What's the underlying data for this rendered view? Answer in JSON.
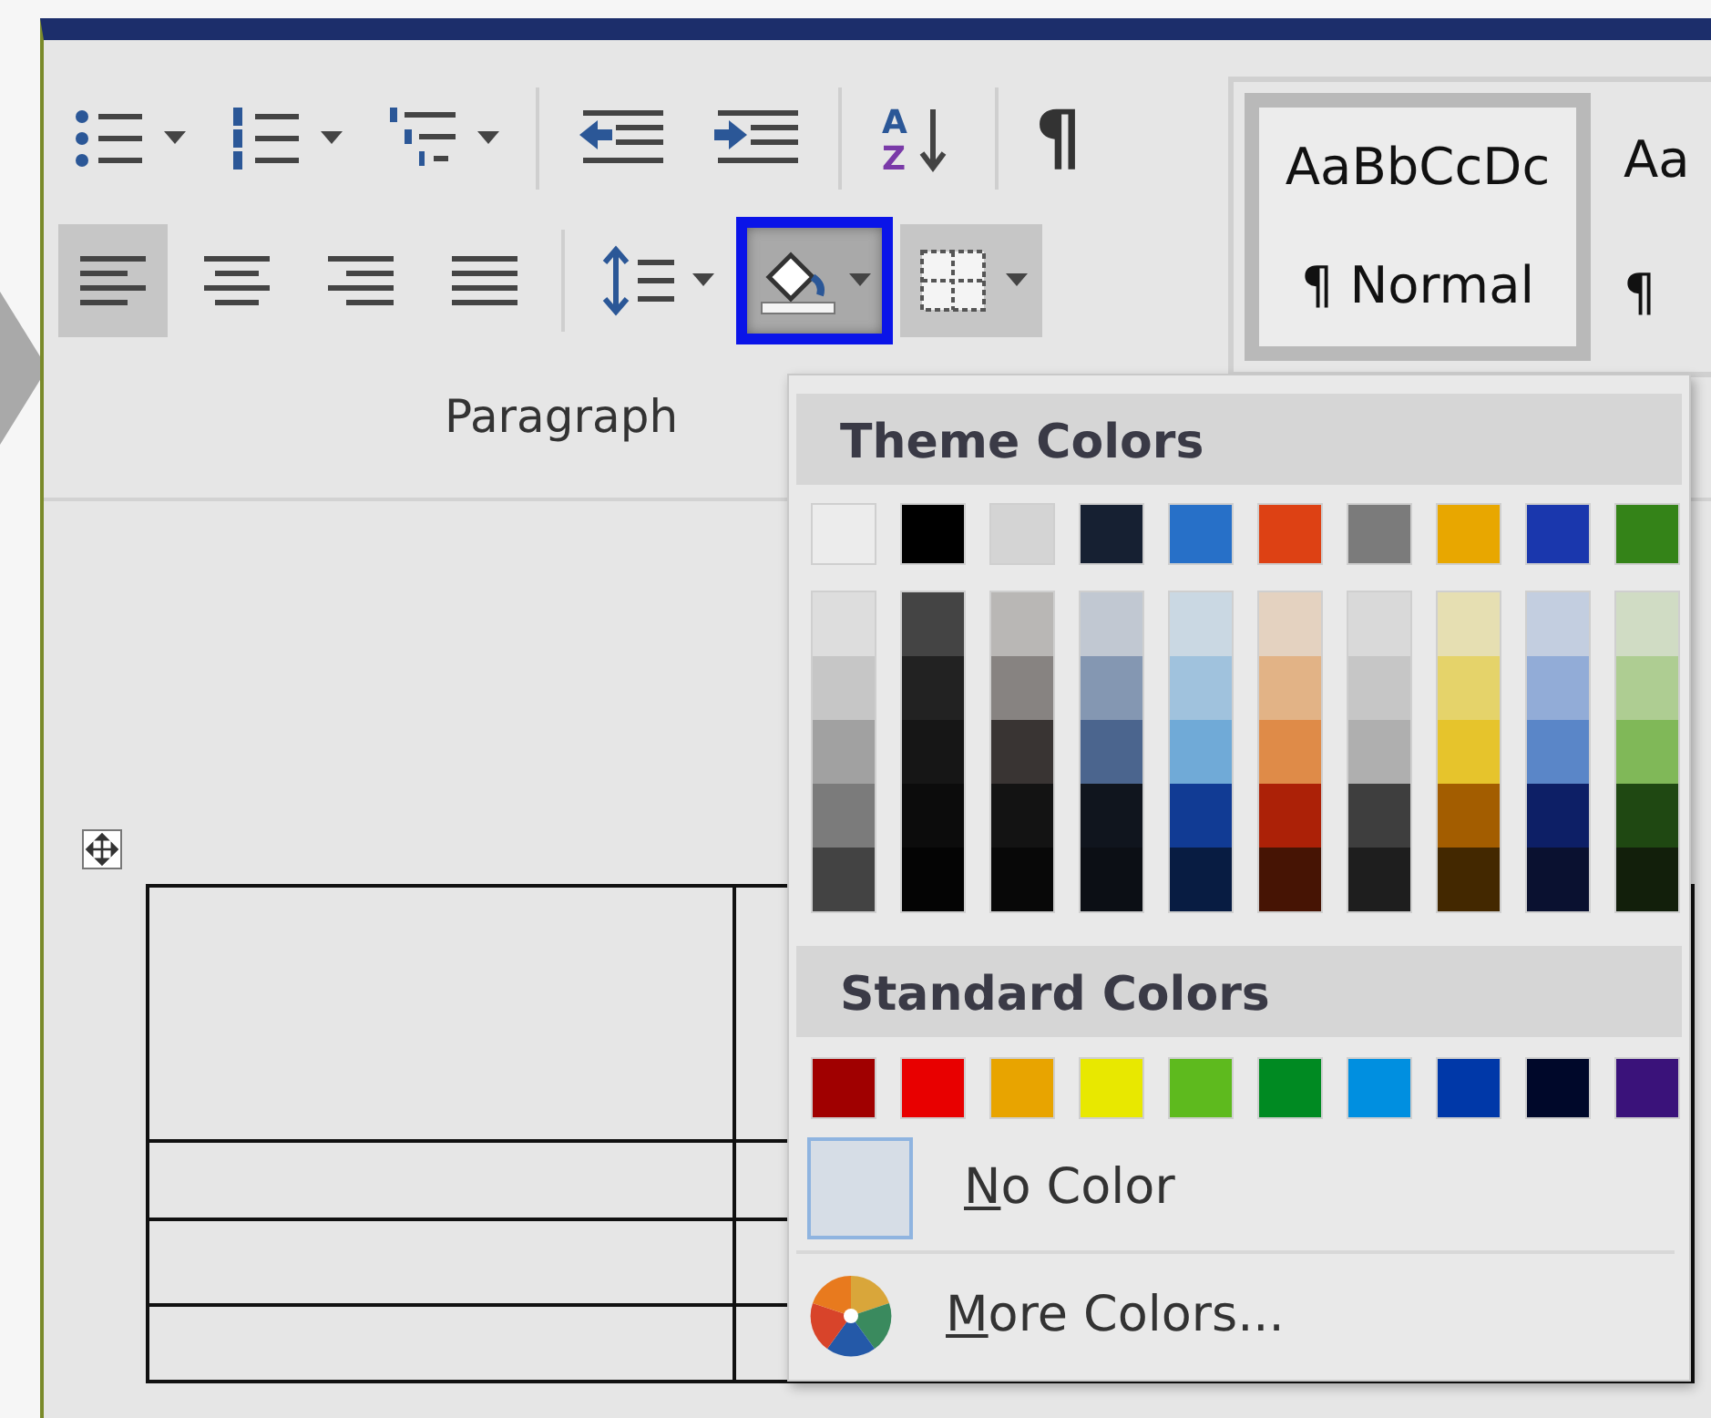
{
  "ribbon": {
    "rows": [
      [
        {
          "kind": "bullets",
          "dropdown": true,
          "selected": false
        },
        {
          "kind": "numbering",
          "dropdown": true,
          "selected": false
        },
        {
          "kind": "multilevel",
          "dropdown": true,
          "selected": false
        },
        {
          "kind": "separator"
        },
        {
          "kind": "outdent",
          "dropdown": false,
          "selected": false
        },
        {
          "kind": "indent",
          "dropdown": false,
          "selected": false
        },
        {
          "kind": "separator"
        },
        {
          "kind": "sort",
          "dropdown": false,
          "selected": false,
          "letters": [
            "A",
            "Z"
          ]
        },
        {
          "kind": "separator"
        },
        {
          "kind": "pilcrow",
          "dropdown": false,
          "selected": false,
          "label": "¶"
        }
      ],
      [
        {
          "kind": "align-left",
          "dropdown": false,
          "selected": true
        },
        {
          "kind": "align-center",
          "dropdown": false,
          "selected": false
        },
        {
          "kind": "align-right",
          "dropdown": false,
          "selected": false
        },
        {
          "kind": "justify",
          "dropdown": false,
          "selected": false
        },
        {
          "kind": "separator"
        },
        {
          "kind": "line-spacing",
          "dropdown": true,
          "selected": false
        },
        {
          "kind": "shading",
          "dropdown": true,
          "selected": true,
          "highlighted": true
        },
        {
          "kind": "borders",
          "dropdown": true,
          "selected": true
        }
      ]
    ],
    "group_label": "Paragraph",
    "styles": [
      {
        "sample": "AaBbCcDc",
        "name": "¶ Normal",
        "selected": true
      },
      {
        "sample": "Aa",
        "name": "¶",
        "selected": false
      }
    ]
  },
  "menu": {
    "theme_title": "Theme Colors",
    "theme_colors": [
      {
        "color": "#ececec"
      },
      {
        "color": "#000000"
      },
      {
        "color": "#d4d4d4"
      },
      {
        "color": "#162032"
      },
      {
        "color": "#2770c8"
      },
      {
        "color": "#dd4114"
      },
      {
        "color": "#7b7b7b"
      },
      {
        "color": "#e8a700"
      },
      {
        "color": "#1a37ad"
      },
      {
        "color": "#348318"
      }
    ],
    "shades": [
      [
        {
          "color": "#dddddd"
        },
        {
          "color": "#c6c6c6"
        },
        {
          "color": "#a1a1a1"
        },
        {
          "color": "#7b7b7b"
        },
        {
          "color": "#434343"
        }
      ],
      [
        {
          "color": "#444444"
        },
        {
          "color": "#222222"
        },
        {
          "color": "#161616"
        },
        {
          "color": "#0c0c0c"
        },
        {
          "color": "#040404"
        }
      ],
      [
        {
          "color": "#b9b7b5"
        },
        {
          "color": "#878381"
        },
        {
          "color": "#393433"
        },
        {
          "color": "#131313"
        },
        {
          "color": "#080808"
        }
      ],
      [
        {
          "color": "#c1c8d2"
        },
        {
          "color": "#8497b2"
        },
        {
          "color": "#4b658e"
        },
        {
          "color": "#10151e"
        },
        {
          "color": "#0c0f15"
        }
      ],
      [
        {
          "color": "#cad8e3"
        },
        {
          "color": "#a0c2dd"
        },
        {
          "color": "#70aad7"
        },
        {
          "color": "#113b94"
        },
        {
          "color": "#081c42"
        }
      ],
      [
        {
          "color": "#e4d2c0"
        },
        {
          "color": "#e2b386"
        },
        {
          "color": "#df8b48"
        },
        {
          "color": "#ac2107"
        },
        {
          "color": "#461404"
        }
      ],
      [
        {
          "color": "#d9d9d9"
        },
        {
          "color": "#c6c6c6"
        },
        {
          "color": "#afafaf"
        },
        {
          "color": "#3e3e3e"
        },
        {
          "color": "#1e1e1e"
        }
      ],
      [
        {
          "color": "#e6dfb2"
        },
        {
          "color": "#e5d36a"
        },
        {
          "color": "#e6c42c"
        },
        {
          "color": "#a35d00"
        },
        {
          "color": "#432800"
        }
      ],
      [
        {
          "color": "#c3cee0"
        },
        {
          "color": "#92acd7"
        },
        {
          "color": "#5a86c8"
        },
        {
          "color": "#0d1f66"
        },
        {
          "color": "#0a1130"
        }
      ],
      [
        {
          "color": "#d0dcc4"
        },
        {
          "color": "#aecd92"
        },
        {
          "color": "#80b858"
        },
        {
          "color": "#1f4812"
        },
        {
          "color": "#121f0b"
        }
      ]
    ],
    "standard_title": "Standard Colors",
    "standard_colors": [
      {
        "color": "#a00000"
      },
      {
        "color": "#e80000"
      },
      {
        "color": "#e8a400"
      },
      {
        "color": "#e8e800"
      },
      {
        "color": "#5eba1e"
      },
      {
        "color": "#008a22"
      },
      {
        "color": "#008fe0"
      },
      {
        "color": "#0038a8"
      },
      {
        "color": "#00082a"
      },
      {
        "color": "#3a127a"
      }
    ],
    "no_color": {
      "label": "No Color"
    },
    "more_colors": {
      "label": "More Colors..."
    }
  }
}
